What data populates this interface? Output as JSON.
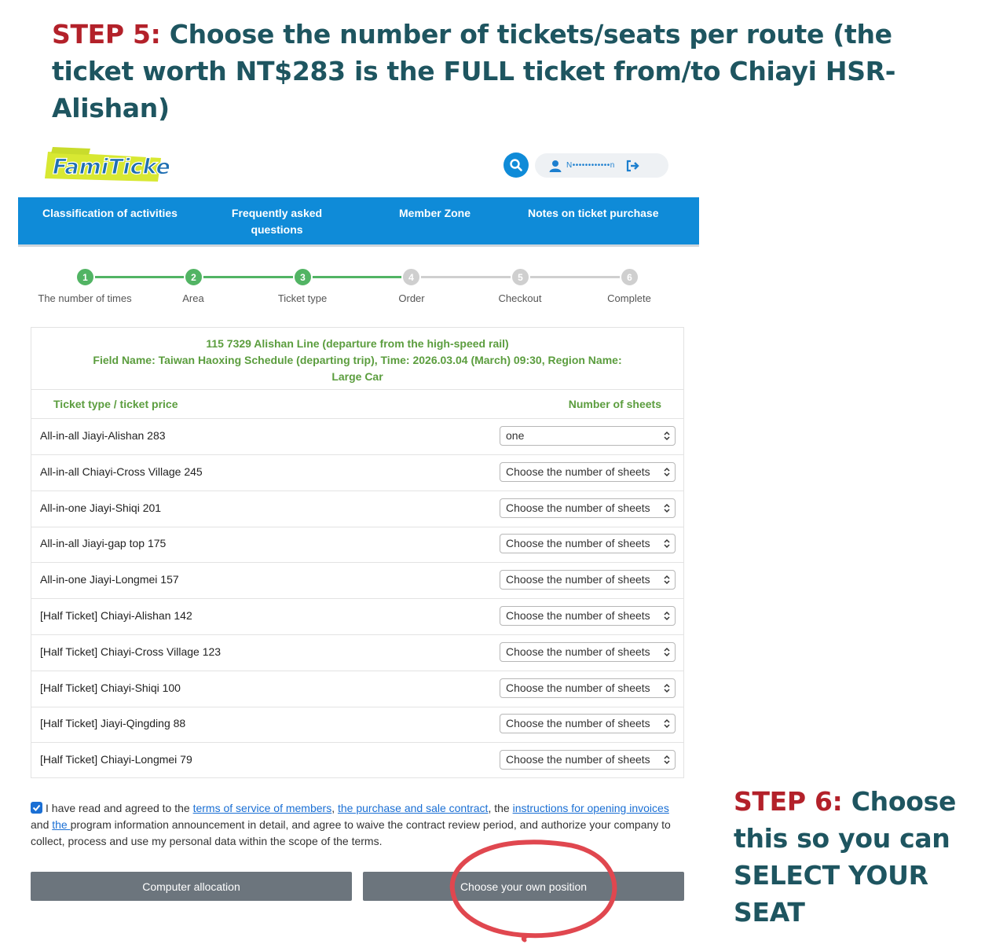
{
  "annotations": {
    "step5_prefix": "STEP 5:",
    "step5_text": " Choose the number of tickets/seats per route (the ticket worth NT$283 is the FULL ticket from/to Chiayi HSR-Alishan)",
    "step6_prefix": "STEP 6:",
    "step6_text": " Choose this so you can SELECT YOUR SEAT"
  },
  "header": {
    "logo_text": "FamiTicket",
    "user_name": "N••••••••••••n",
    "icons": {
      "search": "search-icon",
      "user": "user-icon",
      "logout": "logout-icon"
    }
  },
  "nav": {
    "items": [
      {
        "label": "Classification of activities"
      },
      {
        "label": "Frequently asked questions"
      },
      {
        "label": "Member Zone"
      },
      {
        "label": "Notes on ticket purchase"
      }
    ]
  },
  "stepper": {
    "steps": [
      {
        "number": "1",
        "label": "The number of times",
        "status": "done"
      },
      {
        "number": "2",
        "label": "Area",
        "status": "done"
      },
      {
        "number": "3",
        "label": "Ticket type",
        "status": "current"
      },
      {
        "number": "4",
        "label": "Order",
        "status": "pending"
      },
      {
        "number": "5",
        "label": "Checkout",
        "status": "pending"
      },
      {
        "number": "6",
        "label": "Complete",
        "status": "pending"
      }
    ],
    "colors": {
      "active": "#52b464",
      "pending": "#cfcfcf"
    }
  },
  "event": {
    "line1": "115 7329 Alishan Line (departure from the high-speed rail)",
    "line2": "Field Name: Taiwan Haoxing Schedule (departing trip), Time: 2026.03.04 (March) 09:30, Region Name:",
    "line3": "Large Car"
  },
  "table": {
    "header_left": "Ticket type / ticket price",
    "header_right": "Number of sheets",
    "rows": [
      {
        "name": "All-in-all Jiayi-Alishan 283",
        "selected": "one"
      },
      {
        "name": "All-in-all Chiayi-Cross Village 245",
        "selected": "Choose the number of sheets"
      },
      {
        "name": "All-in-one Jiayi-Shiqi 201",
        "selected": "Choose the number of sheets"
      },
      {
        "name": "All-in-all Jiayi-gap top 175",
        "selected": "Choose the number of sheets"
      },
      {
        "name": "All-in-one Jiayi-Longmei 157",
        "selected": "Choose the number of sheets"
      },
      {
        "name": "[Half Ticket] Chiayi-Alishan 142",
        "selected": "Choose the number of sheets"
      },
      {
        "name": "[Half Ticket] Chiayi-Cross Village 123",
        "selected": "Choose the number of sheets"
      },
      {
        "name": "[Half Ticket] Chiayi-Shiqi 100",
        "selected": "Choose the number of sheets"
      },
      {
        "name": "[Half Ticket] Jiayi-Qingding 88",
        "selected": "Choose the number of sheets"
      },
      {
        "name": "[Half Ticket] Chiayi-Longmei 79",
        "selected": "Choose the number of sheets"
      }
    ]
  },
  "agreement": {
    "checked": true,
    "t1": "I have read and agreed to the ",
    "link1": "terms of service of members",
    "t2": ", ",
    "link2": "the purchase and sale contract",
    "t3": ", the ",
    "link3": "instructions for opening invoices ",
    "t4": "and ",
    "link4": "the ",
    "t5": "program information announcement in detail, and agree to waive the contract review period, and authorize your company to collect, process and use my personal data within the scope of the terms."
  },
  "buttons": {
    "computer_allocation": "Computer allocation",
    "choose_own_position": "Choose your own position"
  },
  "colors": {
    "nav_blue": "#0f8bd8",
    "event_green": "#5b9d3e",
    "annotation_red": "#b3212a",
    "annotation_teal": "#1e5560",
    "highlight_circle": "#e0474f",
    "button_gray": "#6c757d"
  }
}
